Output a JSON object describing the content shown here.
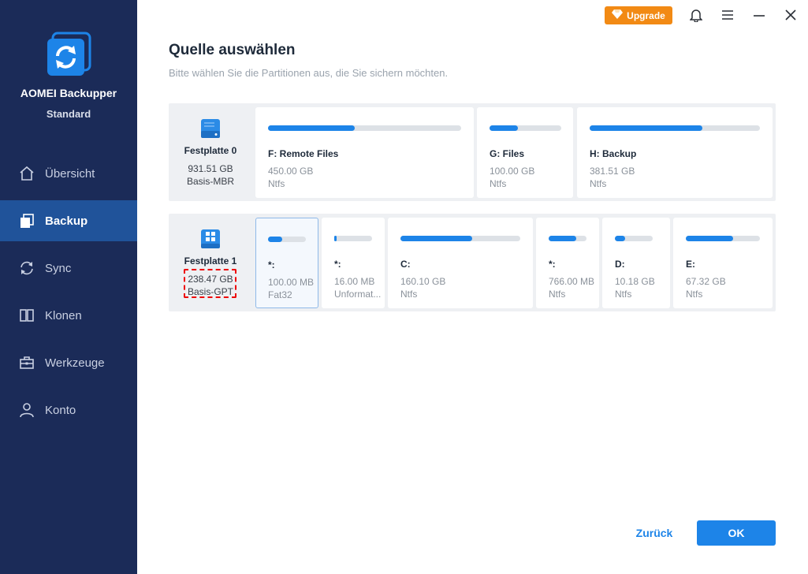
{
  "app": {
    "name": "AOMEI Backupper",
    "edition": "Standard"
  },
  "topbar": {
    "upgrade_label": "Upgrade"
  },
  "nav": [
    {
      "label": "Übersicht",
      "icon": "home-icon",
      "active": false
    },
    {
      "label": "Backup",
      "icon": "backup-icon",
      "active": true
    },
    {
      "label": "Sync",
      "icon": "sync-icon",
      "active": false
    },
    {
      "label": "Klonen",
      "icon": "clone-icon",
      "active": false
    },
    {
      "label": "Werkzeuge",
      "icon": "tools-icon",
      "active": false
    },
    {
      "label": "Konto",
      "icon": "user-icon",
      "active": false
    }
  ],
  "header": {
    "title": "Quelle auswählen",
    "subtitle": "Bitte wählen Sie die Partitionen aus, die Sie sichern möchten."
  },
  "disks": [
    {
      "name": "Festplatte 0",
      "size": "931.51 GB",
      "type": "Basis-MBR",
      "partitions": [
        {
          "label": "F: Remote Files",
          "size": "450.00 GB",
          "fs": "Ntfs",
          "usage": 0.45
        },
        {
          "label": "G: Files",
          "size": "100.00 GB",
          "fs": "Ntfs",
          "usage": 0.4
        },
        {
          "label": "H: Backup",
          "size": "381.51 GB",
          "fs": "Ntfs",
          "usage": 0.66
        }
      ]
    },
    {
      "name": "Festplatte 1",
      "size": "238.47 GB",
      "type": "Basis-GPT",
      "partitions": [
        {
          "label": "*:",
          "size": "100.00 MB",
          "fs": "Fat32",
          "usage": 0.38,
          "selected": true
        },
        {
          "label": "*:",
          "size": "16.00 MB",
          "fs": "Unformat...",
          "usage": 0.06
        },
        {
          "label": "C:",
          "size": "160.10 GB",
          "fs": "Ntfs",
          "usage": 0.6
        },
        {
          "label": "*:",
          "size": "766.00 MB",
          "fs": "Ntfs",
          "usage": 0.72
        },
        {
          "label": "D:",
          "size": "10.18 GB",
          "fs": "Ntfs",
          "usage": 0.27
        },
        {
          "label": "E:",
          "size": "67.32 GB",
          "fs": "Ntfs",
          "usage": 0.64
        }
      ]
    }
  ],
  "buttons": {
    "back": "Zurück",
    "ok": "OK"
  },
  "colors": {
    "sidebar": "#1b2b58",
    "active_nav": "#20539a",
    "accent": "#1d84e8",
    "upgrade": "#f28a14"
  }
}
